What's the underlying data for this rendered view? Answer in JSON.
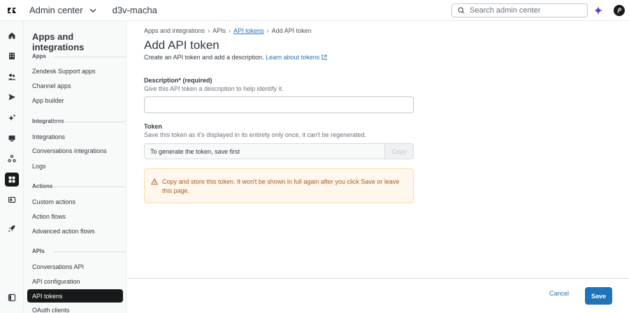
{
  "topbar": {
    "product": "Admin center",
    "account": "d3v-macha",
    "search_placeholder": "Search admin center"
  },
  "sidebar": {
    "title": "Apps and integrations",
    "sections": [
      {
        "label": "Apps",
        "items": [
          "Zendesk Support apps",
          "Channel apps",
          "App builder"
        ]
      },
      {
        "label": "Integrations",
        "items": [
          "Integrations",
          "Conversations integrations",
          "Logs"
        ]
      },
      {
        "label": "Actions",
        "items": [
          "Custom actions",
          "Action flows",
          "Advanced action flows"
        ]
      },
      {
        "label": "APIs",
        "items": [
          "Conversations API",
          "API configuration",
          "API tokens",
          "OAuth clients"
        ]
      }
    ],
    "active_item": "API tokens"
  },
  "breadcrumb": [
    "Apps and integrations",
    "APIs",
    "API tokens",
    "Add API token"
  ],
  "page": {
    "title": "Add API token",
    "subtitle": "Create an API token and add a description.",
    "learn_link": "Learn about tokens"
  },
  "form": {
    "description_label": "Description* (required)",
    "description_hint": "Give this API token a description to help identify it.",
    "description_value": "",
    "token_label": "Token",
    "token_hint": "Save this token as it's displayed in its entirety only once, it can't be regenerated.",
    "token_value": "To generate the token, save first",
    "copy_label": "Copy"
  },
  "alert": {
    "text": "Copy and store this token. It won't be shown in full again after you click Save or leave this page."
  },
  "footer": {
    "cancel_label": "Cancel",
    "save_label": "Save"
  },
  "colors": {
    "accent": "#1f73b7",
    "dark": "#17191a",
    "warning_bg": "#fff7ed",
    "warning_text": "#ad5918"
  }
}
